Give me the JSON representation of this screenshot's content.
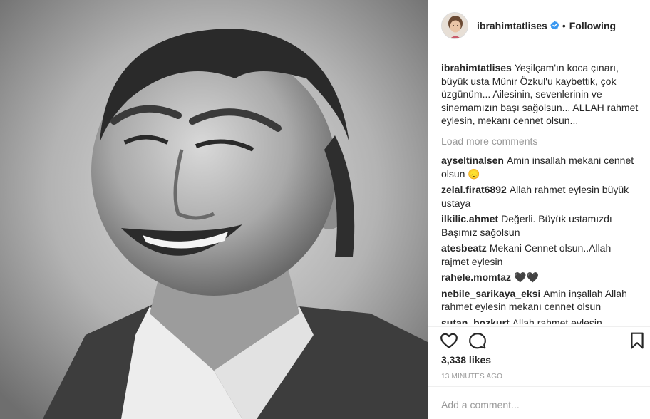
{
  "post": {
    "photo_icon": "black-and-white-portrait-smiling-man"
  },
  "header": {
    "username": "ibrahimtatlises",
    "verified_icon": "verified-badge-icon",
    "separator": "•",
    "follow_status": "Following"
  },
  "caption": {
    "username": "ibrahimtatlises",
    "text": "Yeşilçam'ın koca çınarı, büyük usta Münir Özkul'u kaybettik, çok üzgünüm... Ailesinin, sevenlerinin ve sinemamızın başı sağolsun... ALLAH rahmet eylesin, mekanı cennet olsun..."
  },
  "load_more": "Load more comments",
  "comments": [
    {
      "username": "ayseltinalsen",
      "text": "Amin insallah mekani cennet olsun 😞"
    },
    {
      "username": "zelal.firat6892",
      "text": "Allah rahmet eylesin büyük ustaya"
    },
    {
      "username": "ilkilic.ahmet",
      "text": "Değerli. Büyük ustamızdı Başımız sağolsun"
    },
    {
      "username": "atesbeatz",
      "text": "Mekani Cennet olsun..Allah rajmet eylesin"
    },
    {
      "username": "rahele.momtaz",
      "text": "🖤🖤"
    },
    {
      "username": "nebile_sarikaya_eksi",
      "text": "Amin inşallah Allah rahmet eylesin mekanı cennet olsun"
    },
    {
      "username": "sutan_bozkurt",
      "text": "Allah rahmet eylesin"
    }
  ],
  "actions": {
    "like_icon": "heart-icon",
    "comment_icon": "comment-bubble-icon",
    "save_icon": "bookmark-icon"
  },
  "likes": "3,338 likes",
  "timestamp": "13 MINUTES AGO",
  "add_comment": {
    "placeholder": "Add a comment..."
  },
  "colors": {
    "text": "#262626",
    "muted": "#999999",
    "divider": "#efefef",
    "verified": "#3897f0"
  }
}
